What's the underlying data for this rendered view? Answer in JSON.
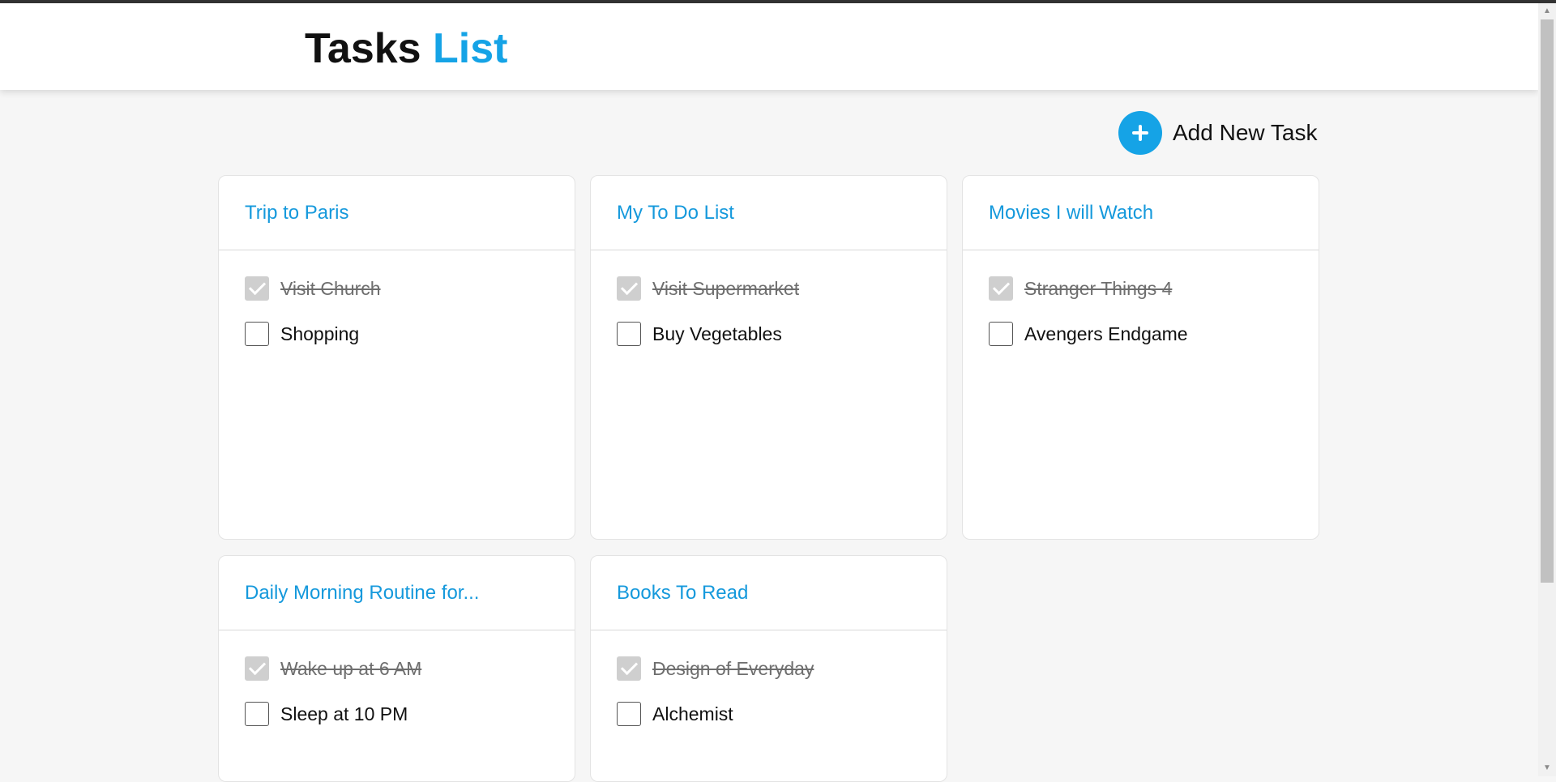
{
  "header": {
    "title_main": "Tasks",
    "title_accent": "List"
  },
  "actions": {
    "add_task_label": "Add New Task",
    "add_icon": "plus-circle-icon"
  },
  "colors": {
    "accent": "#15a3e6",
    "title": "#1599dc"
  },
  "lists": [
    {
      "title": "Trip to Paris",
      "tasks": [
        {
          "text": "Visit Church",
          "done": true
        },
        {
          "text": "Shopping",
          "done": false
        }
      ]
    },
    {
      "title": "My To Do List",
      "tasks": [
        {
          "text": "Visit Supermarket",
          "done": true
        },
        {
          "text": "Buy Vegetables",
          "done": false
        }
      ]
    },
    {
      "title": "Movies I will Watch",
      "tasks": [
        {
          "text": "Stranger Things 4",
          "done": true
        },
        {
          "text": "Avengers Endgame",
          "done": false
        }
      ]
    },
    {
      "title": "Daily Morning Routine for...",
      "tasks": [
        {
          "text": "Wake up at 6 AM",
          "done": true
        },
        {
          "text": "Sleep at 10 PM",
          "done": false
        }
      ]
    },
    {
      "title": "Books To Read",
      "tasks": [
        {
          "text": "Design of Everyday",
          "done": true
        },
        {
          "text": "Alchemist",
          "done": false
        }
      ]
    }
  ]
}
